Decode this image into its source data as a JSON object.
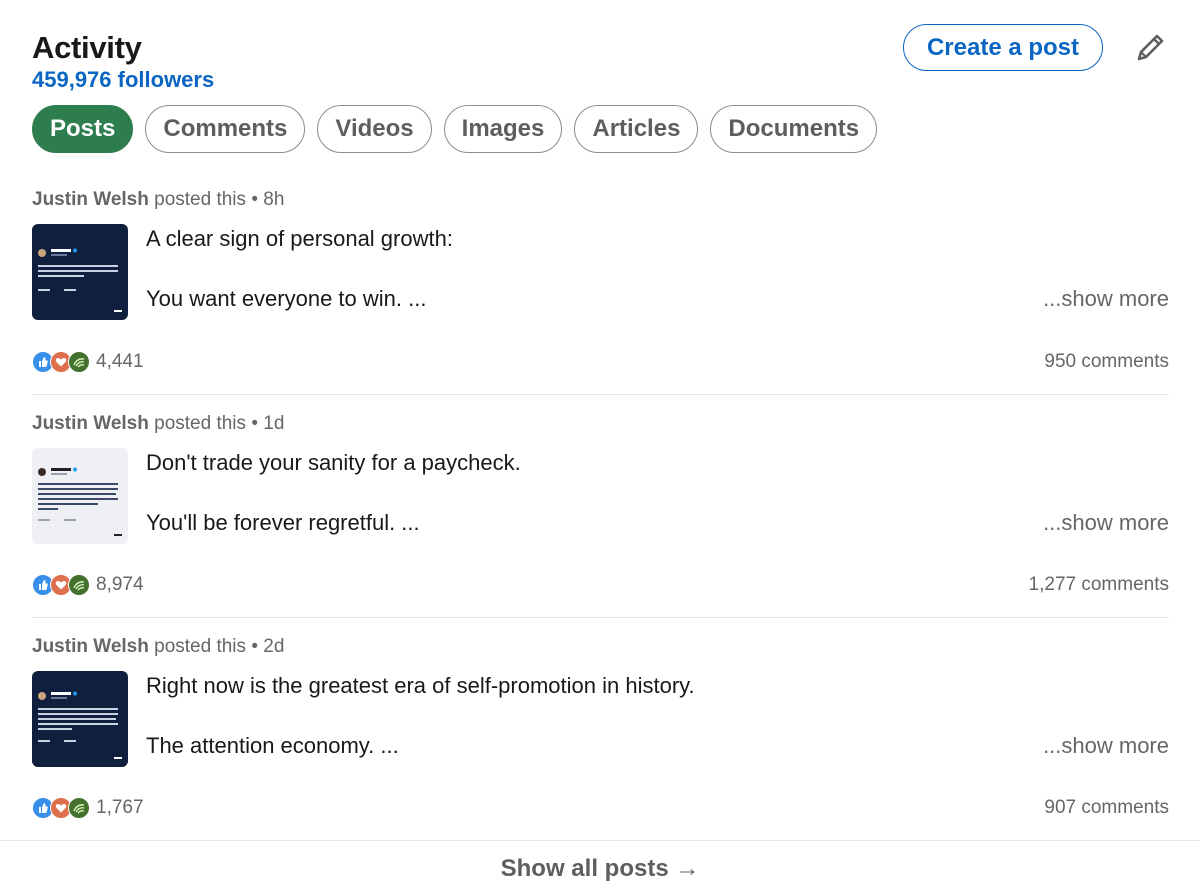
{
  "header": {
    "title": "Activity",
    "followers": "459,976 followers",
    "create_post_label": "Create a post",
    "edit_icon": "pencil-icon"
  },
  "filters": [
    "Posts",
    "Comments",
    "Videos",
    "Images",
    "Articles",
    "Documents"
  ],
  "active_filter": "Posts",
  "posts": [
    {
      "author": "Justin Welsh",
      "action": "posted this",
      "separator": "•",
      "time": "8h",
      "line1": "A clear sign of personal growth:",
      "line2": "You want everyone to win. ...",
      "show_more": "...show more",
      "reactions": "4,441",
      "comments": "950 comments"
    },
    {
      "author": "Justin Welsh",
      "action": "posted this",
      "separator": "•",
      "time": "1d",
      "line1": "Don't trade your sanity for a paycheck.",
      "line2": "You'll be forever regretful. ...",
      "show_more": "...show more",
      "reactions": "8,974",
      "comments": "1,277 comments"
    },
    {
      "author": "Justin Welsh",
      "action": "posted this",
      "separator": "•",
      "time": "2d",
      "line1": "Right now is the greatest era of self-promotion in history.",
      "line2": "The attention economy. ...",
      "show_more": "...show more",
      "reactions": "1,767",
      "comments": "907 comments"
    }
  ],
  "show_all": "Show all posts →",
  "colors": {
    "brand_blue": "#0a66c2",
    "active_pill": "#2e7d4f",
    "like": "#378fe9",
    "love": "#df704d",
    "support": "#44712e"
  }
}
